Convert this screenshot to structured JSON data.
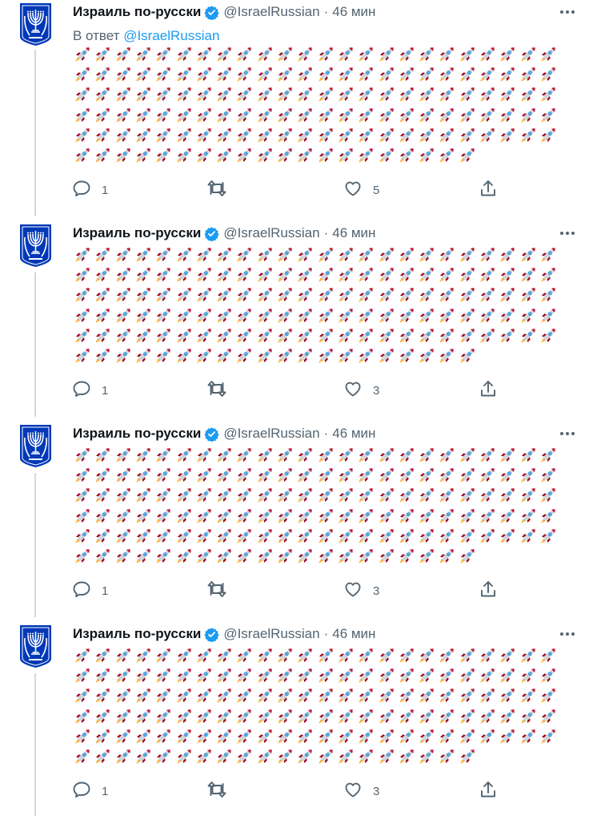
{
  "colors": {
    "text": "#0f1419",
    "secondary": "#536471",
    "link": "#1d9bf0",
    "thread_line": "#cfd9de",
    "avatar_blue": "#0038b8"
  },
  "rocket_emoji": "🚀",
  "tweets": [
    {
      "name": "Израиль по-русски",
      "handle": "@IsraelRussian",
      "separator": "·",
      "time": "46 мин",
      "reply_prefix": "В ответ",
      "reply_mention": "@IsraelRussian",
      "emoji_rows": [
        24,
        24,
        24,
        24,
        24,
        20
      ],
      "reply_count": "1",
      "retweet_count": "",
      "like_count": "5"
    },
    {
      "name": "Израиль по-русски",
      "handle": "@IsraelRussian",
      "separator": "·",
      "time": "46 мин",
      "emoji_rows": [
        24,
        24,
        24,
        24,
        24,
        20
      ],
      "reply_count": "1",
      "retweet_count": "",
      "like_count": "3"
    },
    {
      "name": "Израиль по-русски",
      "handle": "@IsraelRussian",
      "separator": "·",
      "time": "46 мин",
      "emoji_rows": [
        24,
        24,
        24,
        24,
        24,
        20
      ],
      "reply_count": "1",
      "retweet_count": "",
      "like_count": "3"
    },
    {
      "name": "Израиль по-русски",
      "handle": "@IsraelRussian",
      "separator": "·",
      "time": "46 мин",
      "emoji_rows": [
        24,
        24,
        24,
        24,
        24,
        20
      ],
      "reply_count": "1",
      "retweet_count": "",
      "like_count": "3"
    }
  ]
}
